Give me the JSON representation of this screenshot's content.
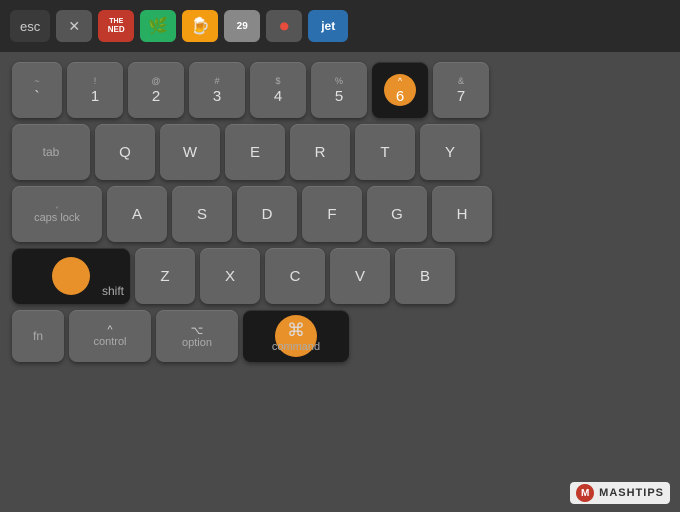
{
  "touchbar": {
    "esc_label": "esc",
    "icons": [
      {
        "name": "close",
        "symbol": "✕",
        "class": "tb-close"
      },
      {
        "name": "ned",
        "symbol": "NED",
        "class": "tb-ned"
      },
      {
        "name": "leaf",
        "symbol": "🌿",
        "class": "tb-leaf"
      },
      {
        "name": "bottle",
        "symbol": "🍺",
        "class": "tb-bottle"
      },
      {
        "name": "num29",
        "symbol": "29",
        "class": "tb-num"
      },
      {
        "name": "record",
        "symbol": "⏺",
        "class": "tb-rec"
      },
      {
        "name": "jet",
        "symbol": "jet",
        "class": "tb-jet"
      }
    ]
  },
  "keyboard": {
    "row1": {
      "keys": [
        "~\n`",
        "!\n1",
        "@\n2",
        "#\n3",
        "$\n4",
        "%\n5",
        "^\n6",
        "&\n7"
      ]
    },
    "row2": {
      "modifier": "tab",
      "keys": [
        "Q",
        "W",
        "E",
        "R",
        "T",
        "Y"
      ]
    },
    "row3": {
      "modifier": "caps lock",
      "keys": [
        "A",
        "S",
        "D",
        "F",
        "G",
        "H"
      ]
    },
    "row4": {
      "modifier": "shift",
      "keys": [
        "Z",
        "X",
        "C",
        "V",
        "B"
      ]
    },
    "row5": {
      "keys": [
        {
          "label": "fn",
          "sub": ""
        },
        {
          "label": "control",
          "sub": "^"
        },
        {
          "label": "option",
          "sub": "⌥"
        },
        {
          "label": "command",
          "sub": "⌘"
        }
      ]
    }
  },
  "watermark": {
    "logo": "M",
    "text": "MASHTIPS"
  }
}
